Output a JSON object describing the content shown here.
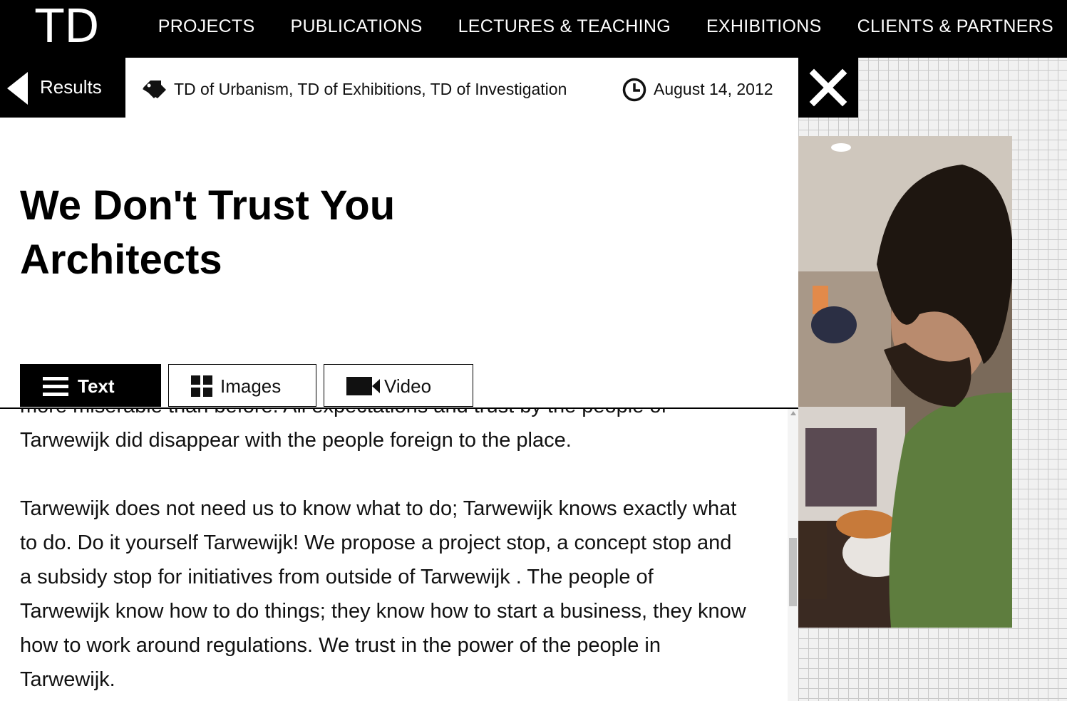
{
  "logo": "TD",
  "nav": {
    "items": [
      "PROJECTS",
      "PUBLICATIONS",
      "LECTURES & TEACHING",
      "EXHIBITIONS",
      "CLIENTS & PARTNERS"
    ]
  },
  "back": {
    "label": "Results"
  },
  "meta": {
    "tags": "TD of Urbanism, TD of Exhibitions, TD of Investigation",
    "date": "August 14, 2012"
  },
  "article": {
    "title_line1": "We Don't Trust You",
    "title_line2": "Architects",
    "paragraphs": [
      "more miserable than before. All expectations and trust by the people of Tarwewijk did disappear with the people foreign to the place.",
      "Tarwewijk does not need us to know what to do; Tarwewijk knows exactly what to do. Do it yourself Tarwewijk! We propose a project stop, a concept stop and a subsidy stop for initiatives from outside of Tarwewijk . The people of Tarwewijk know how to do things; they know how to start a business, they know how to work around regulations. We trust in the power of the people in Tarwewijk."
    ]
  },
  "tabs": [
    {
      "label": "Text",
      "icon": "list-icon",
      "active": true
    },
    {
      "label": "Images",
      "icon": "grid-icon",
      "active": false
    },
    {
      "label": "Video",
      "icon": "video-camera-icon",
      "active": false
    }
  ],
  "colors": {
    "bar": "#000000",
    "panel": "#ffffff",
    "grid_bg": "#f1f1f1",
    "grid_line": "#c9c9c9"
  }
}
